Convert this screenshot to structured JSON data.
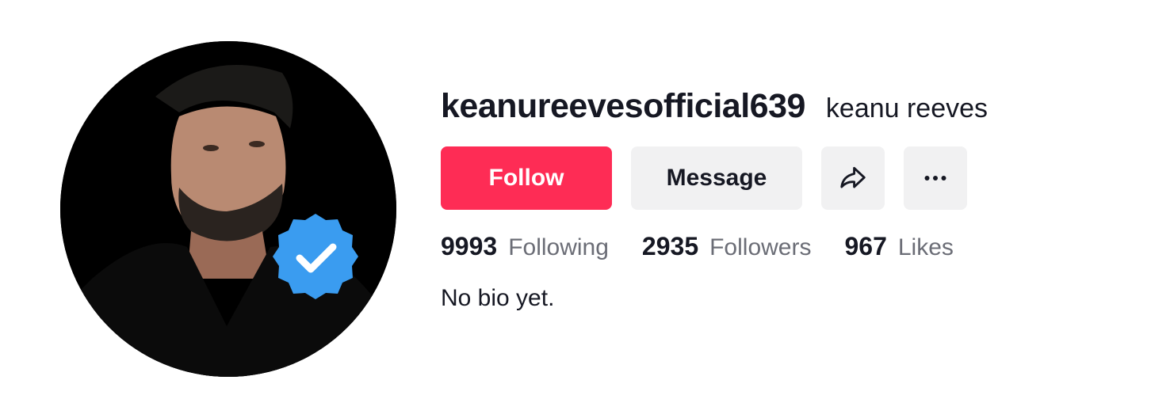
{
  "profile": {
    "username": "keanureevesofficial639",
    "nickname": "keanu reeves",
    "verified": true,
    "avatar_icon": "profile-photo"
  },
  "actions": {
    "follow_label": "Follow",
    "message_label": "Message",
    "share_icon": "share-icon",
    "more_icon": "more-icon"
  },
  "stats": {
    "following_count": "9993",
    "following_label": "Following",
    "followers_count": "2935",
    "followers_label": "Followers",
    "likes_count": "967",
    "likes_label": "Likes"
  },
  "bio": "No bio yet.",
  "colors": {
    "accent": "#fe2c55",
    "button_bg": "#f1f1f2",
    "text_primary": "#161823",
    "text_secondary": "#6b6d76",
    "verified_blue": "#3a9cf0"
  }
}
